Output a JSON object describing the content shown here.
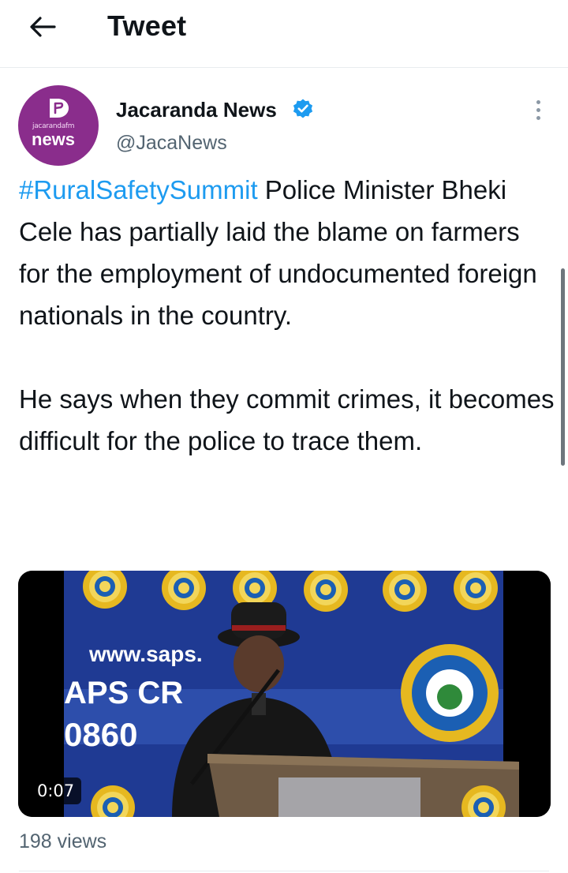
{
  "header": {
    "title": "Tweet",
    "back_icon": "arrow-left-icon"
  },
  "author": {
    "name": "Jacaranda News",
    "handle": "@JacaNews",
    "verified": true,
    "avatar": {
      "small_text": "jacarandafm",
      "main_text": "news",
      "color": "#8a2d8c"
    }
  },
  "tweet": {
    "hashtag": "#RuralSafetySummit",
    "paragraph1_rest": " Police Minister Bheki Cele has partially laid the blame on farmers for the employment of undocumented foreign nationals in the country.",
    "paragraph2": "He says when they commit crimes, it becomes difficult for the police to trace them."
  },
  "video": {
    "duration": "0:07",
    "backdrop_text": {
      "line1": "www.saps.",
      "line2": "APS CR",
      "line3": "0860"
    }
  },
  "stats": {
    "views": "198 views"
  },
  "colors": {
    "link": "#1d9bf0",
    "secondary_text": "#536471",
    "divider": "#e8ecef",
    "verified_badge": "#1d9bf0",
    "video_backdrop": "#1f3a93"
  }
}
